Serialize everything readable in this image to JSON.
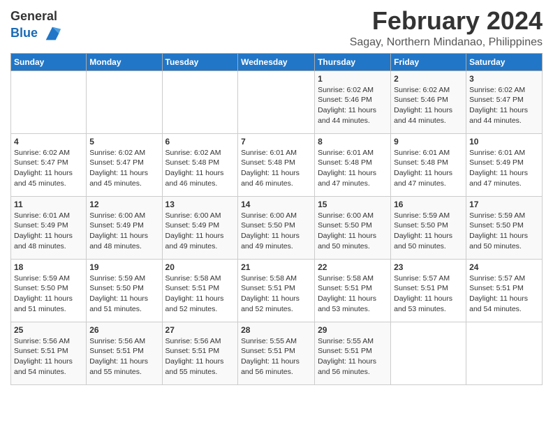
{
  "logo": {
    "line1": "General",
    "line2": "Blue"
  },
  "header": {
    "month": "February 2024",
    "location": "Sagay, Northern Mindanao, Philippines"
  },
  "days_of_week": [
    "Sunday",
    "Monday",
    "Tuesday",
    "Wednesday",
    "Thursday",
    "Friday",
    "Saturday"
  ],
  "weeks": [
    [
      {
        "day": "",
        "info": ""
      },
      {
        "day": "",
        "info": ""
      },
      {
        "day": "",
        "info": ""
      },
      {
        "day": "",
        "info": ""
      },
      {
        "day": "1",
        "info": "Sunrise: 6:02 AM\nSunset: 5:46 PM\nDaylight: 11 hours and 44 minutes."
      },
      {
        "day": "2",
        "info": "Sunrise: 6:02 AM\nSunset: 5:46 PM\nDaylight: 11 hours and 44 minutes."
      },
      {
        "day": "3",
        "info": "Sunrise: 6:02 AM\nSunset: 5:47 PM\nDaylight: 11 hours and 44 minutes."
      }
    ],
    [
      {
        "day": "4",
        "info": "Sunrise: 6:02 AM\nSunset: 5:47 PM\nDaylight: 11 hours and 45 minutes."
      },
      {
        "day": "5",
        "info": "Sunrise: 6:02 AM\nSunset: 5:47 PM\nDaylight: 11 hours and 45 minutes."
      },
      {
        "day": "6",
        "info": "Sunrise: 6:02 AM\nSunset: 5:48 PM\nDaylight: 11 hours and 46 minutes."
      },
      {
        "day": "7",
        "info": "Sunrise: 6:01 AM\nSunset: 5:48 PM\nDaylight: 11 hours and 46 minutes."
      },
      {
        "day": "8",
        "info": "Sunrise: 6:01 AM\nSunset: 5:48 PM\nDaylight: 11 hours and 47 minutes."
      },
      {
        "day": "9",
        "info": "Sunrise: 6:01 AM\nSunset: 5:48 PM\nDaylight: 11 hours and 47 minutes."
      },
      {
        "day": "10",
        "info": "Sunrise: 6:01 AM\nSunset: 5:49 PM\nDaylight: 11 hours and 47 minutes."
      }
    ],
    [
      {
        "day": "11",
        "info": "Sunrise: 6:01 AM\nSunset: 5:49 PM\nDaylight: 11 hours and 48 minutes."
      },
      {
        "day": "12",
        "info": "Sunrise: 6:00 AM\nSunset: 5:49 PM\nDaylight: 11 hours and 48 minutes."
      },
      {
        "day": "13",
        "info": "Sunrise: 6:00 AM\nSunset: 5:49 PM\nDaylight: 11 hours and 49 minutes."
      },
      {
        "day": "14",
        "info": "Sunrise: 6:00 AM\nSunset: 5:50 PM\nDaylight: 11 hours and 49 minutes."
      },
      {
        "day": "15",
        "info": "Sunrise: 6:00 AM\nSunset: 5:50 PM\nDaylight: 11 hours and 50 minutes."
      },
      {
        "day": "16",
        "info": "Sunrise: 5:59 AM\nSunset: 5:50 PM\nDaylight: 11 hours and 50 minutes."
      },
      {
        "day": "17",
        "info": "Sunrise: 5:59 AM\nSunset: 5:50 PM\nDaylight: 11 hours and 50 minutes."
      }
    ],
    [
      {
        "day": "18",
        "info": "Sunrise: 5:59 AM\nSunset: 5:50 PM\nDaylight: 11 hours and 51 minutes."
      },
      {
        "day": "19",
        "info": "Sunrise: 5:59 AM\nSunset: 5:50 PM\nDaylight: 11 hours and 51 minutes."
      },
      {
        "day": "20",
        "info": "Sunrise: 5:58 AM\nSunset: 5:51 PM\nDaylight: 11 hours and 52 minutes."
      },
      {
        "day": "21",
        "info": "Sunrise: 5:58 AM\nSunset: 5:51 PM\nDaylight: 11 hours and 52 minutes."
      },
      {
        "day": "22",
        "info": "Sunrise: 5:58 AM\nSunset: 5:51 PM\nDaylight: 11 hours and 53 minutes."
      },
      {
        "day": "23",
        "info": "Sunrise: 5:57 AM\nSunset: 5:51 PM\nDaylight: 11 hours and 53 minutes."
      },
      {
        "day": "24",
        "info": "Sunrise: 5:57 AM\nSunset: 5:51 PM\nDaylight: 11 hours and 54 minutes."
      }
    ],
    [
      {
        "day": "25",
        "info": "Sunrise: 5:56 AM\nSunset: 5:51 PM\nDaylight: 11 hours and 54 minutes."
      },
      {
        "day": "26",
        "info": "Sunrise: 5:56 AM\nSunset: 5:51 PM\nDaylight: 11 hours and 55 minutes."
      },
      {
        "day": "27",
        "info": "Sunrise: 5:56 AM\nSunset: 5:51 PM\nDaylight: 11 hours and 55 minutes."
      },
      {
        "day": "28",
        "info": "Sunrise: 5:55 AM\nSunset: 5:51 PM\nDaylight: 11 hours and 56 minutes."
      },
      {
        "day": "29",
        "info": "Sunrise: 5:55 AM\nSunset: 5:51 PM\nDaylight: 11 hours and 56 minutes."
      },
      {
        "day": "",
        "info": ""
      },
      {
        "day": "",
        "info": ""
      }
    ]
  ]
}
